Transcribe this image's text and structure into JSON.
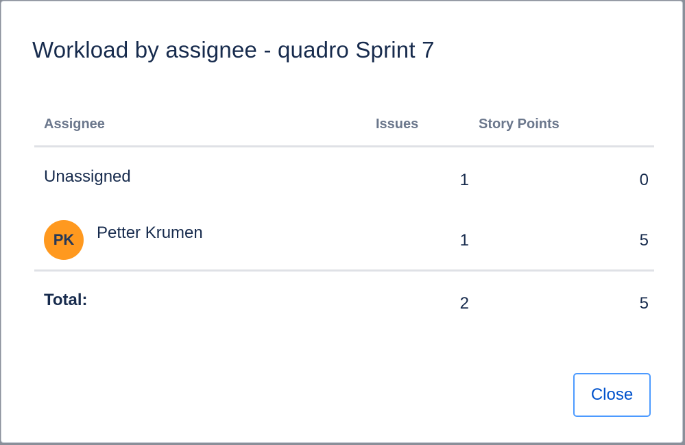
{
  "dialog": {
    "title": "Workload by assignee - quadro Sprint 7",
    "close_label": "Close"
  },
  "table": {
    "columns": {
      "assignee": "Assignee",
      "issues": "Issues",
      "story_points": "Story Points"
    },
    "rows": [
      {
        "assignee": "Unassigned",
        "avatar": null,
        "issues": "1",
        "story_points": "0"
      },
      {
        "assignee": "Petter Krumen",
        "avatar": {
          "initials": "PK",
          "color": "#ff991f"
        },
        "issues": "1",
        "story_points": "5"
      }
    ],
    "total": {
      "label": "Total:",
      "issues": "2",
      "story_points": "5"
    }
  },
  "colors": {
    "title": "#172b4d",
    "header_text": "#6b778c",
    "rule": "#dfe1e6",
    "button_border": "#4c9aff",
    "button_text": "#0052cc"
  }
}
